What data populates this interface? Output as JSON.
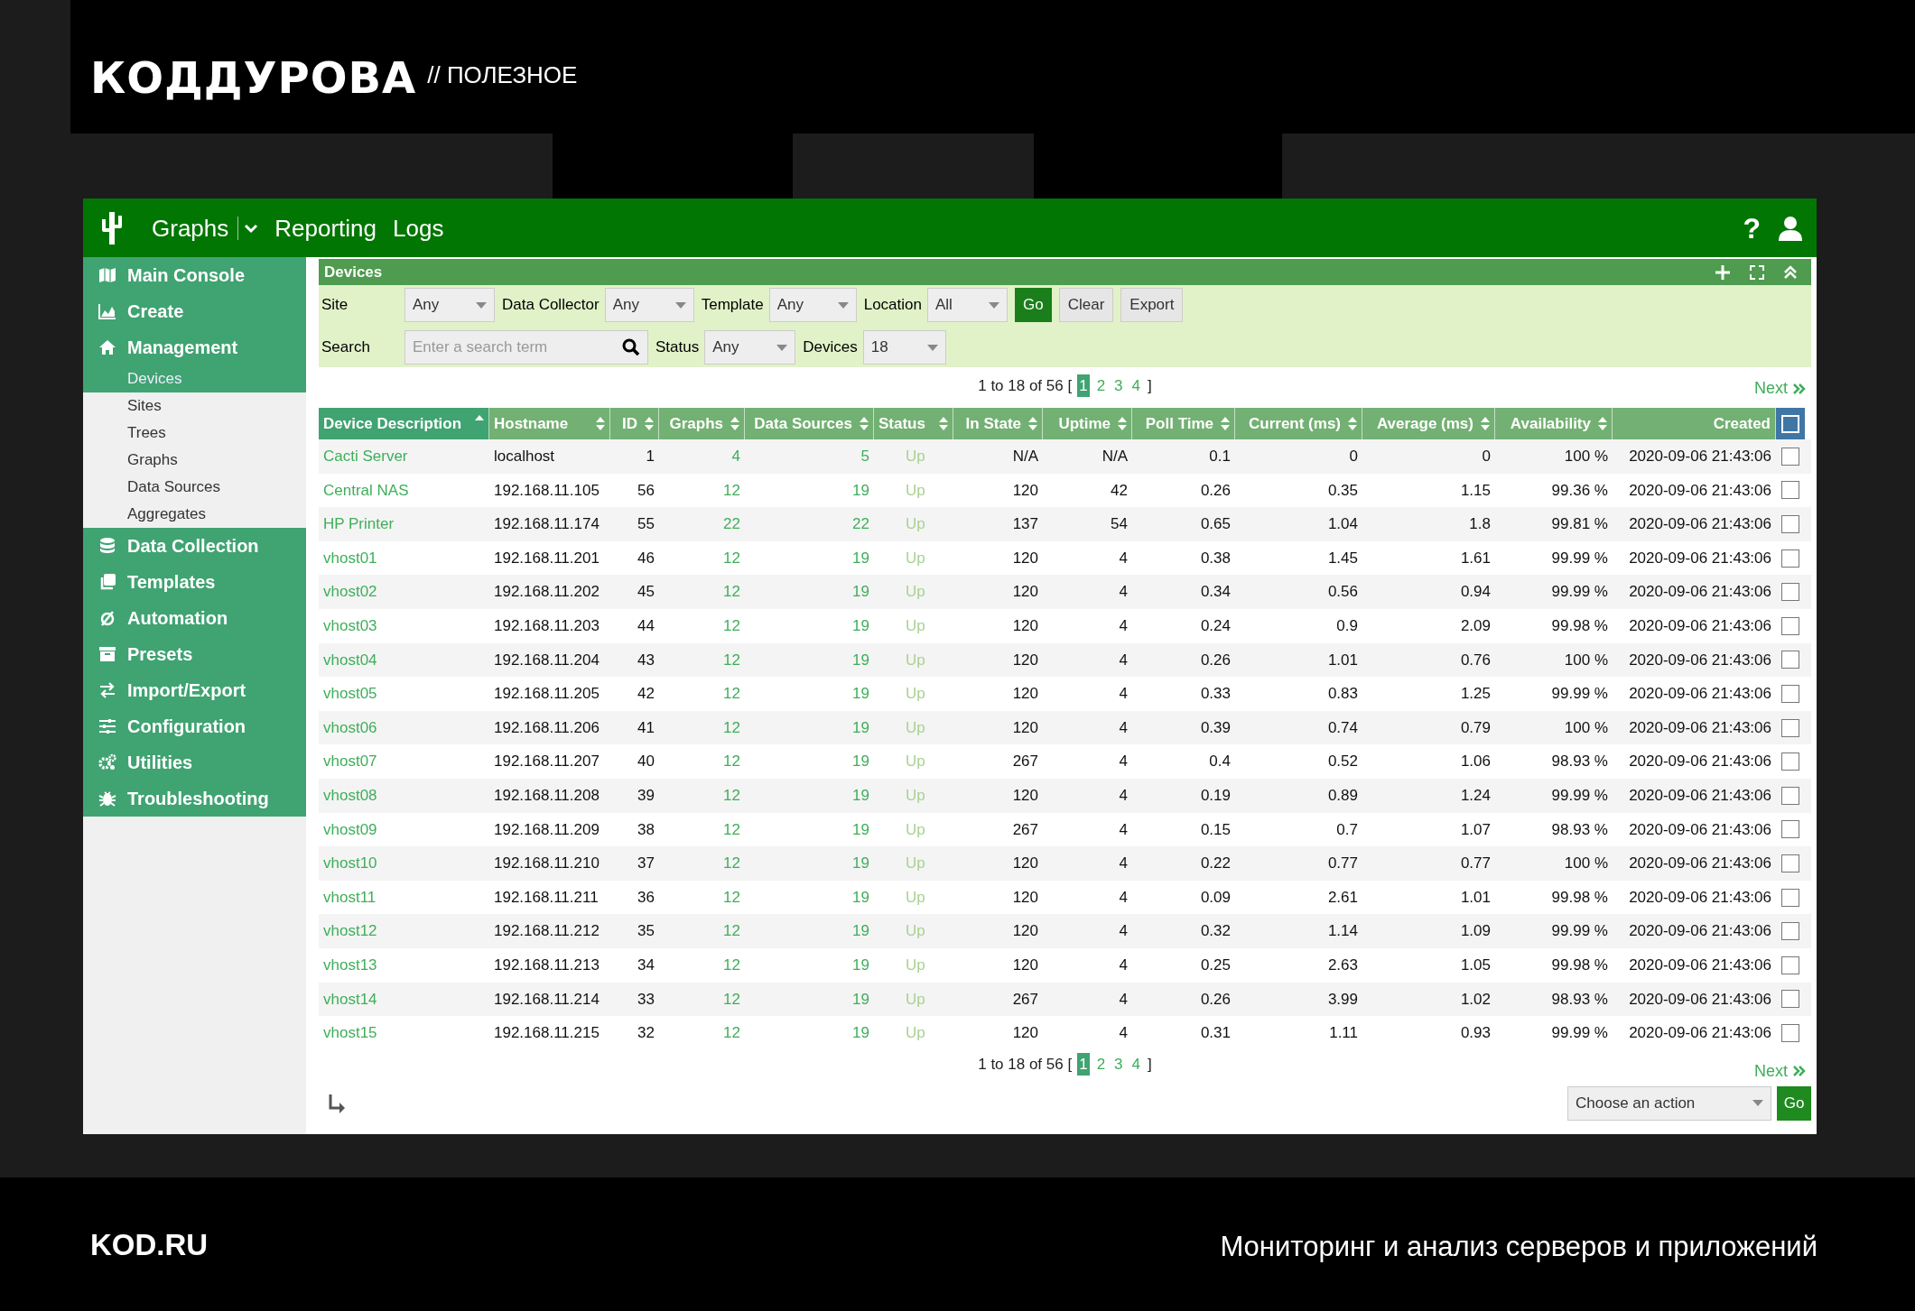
{
  "branding": {
    "logo": "КОДДУРОВА",
    "tagline": "// ПОЛЕЗНОЕ",
    "site": "KOD.RU",
    "caption": "Мониторинг и анализ серверов и приложений"
  },
  "navbar": {
    "tabs": [
      {
        "label": "Graphs",
        "dropdown": true
      },
      {
        "label": "Reporting",
        "dropdown": false
      },
      {
        "label": "Logs",
        "dropdown": false
      }
    ],
    "help": "?"
  },
  "sidebar": {
    "items": [
      {
        "label": "Main Console"
      },
      {
        "label": "Create"
      },
      {
        "label": "Management",
        "children": [
          {
            "label": "Devices",
            "selected": true
          },
          {
            "label": "Sites",
            "selected": false
          },
          {
            "label": "Trees",
            "selected": false
          },
          {
            "label": "Graphs",
            "selected": false
          },
          {
            "label": "Data Sources",
            "selected": false
          },
          {
            "label": "Aggregates",
            "selected": false
          }
        ]
      },
      {
        "label": "Data Collection"
      },
      {
        "label": "Templates"
      },
      {
        "label": "Automation"
      },
      {
        "label": "Presets"
      },
      {
        "label": "Import/Export"
      },
      {
        "label": "Configuration"
      },
      {
        "label": "Utilities"
      },
      {
        "label": "Troubleshooting"
      }
    ]
  },
  "panel": {
    "title": "Devices",
    "filter_rows": [
      [
        {
          "kind": "select",
          "label": "Site",
          "value": "Any"
        },
        {
          "kind": "select",
          "label": "Data Collector",
          "value": "Any"
        },
        {
          "kind": "select",
          "label": "Template",
          "value": "Any"
        },
        {
          "kind": "select",
          "label": "Location",
          "value": "All"
        },
        {
          "kind": "primary_button",
          "label": "Go"
        },
        {
          "kind": "button",
          "label": "Clear"
        },
        {
          "kind": "button",
          "label": "Export"
        }
      ],
      [
        {
          "kind": "search",
          "label": "Search",
          "placeholder": "Enter a search term"
        },
        {
          "kind": "select",
          "label": "Status",
          "value": "Any"
        },
        {
          "kind": "select",
          "label": "Devices",
          "value": "18"
        }
      ]
    ],
    "pagination_top": {
      "summary": "1 to 18 of 56 [",
      "pages": [
        {
          "label": "1",
          "selected": true
        },
        {
          "label": "2",
          "selected": false
        },
        {
          "label": "3",
          "selected": false
        },
        {
          "label": "4",
          "selected": false
        }
      ],
      "close": "]",
      "next": "Next"
    },
    "table": {
      "columns": [
        {
          "label": "Device Description",
          "sortable": true,
          "sorted": true
        },
        {
          "label": "Hostname",
          "sortable": true,
          "sorted": false
        },
        {
          "label": "ID",
          "sortable": true,
          "sorted": false
        },
        {
          "label": "Graphs",
          "sortable": true,
          "sorted": false
        },
        {
          "label": "Data Sources",
          "sortable": true,
          "sorted": false
        },
        {
          "label": "Status",
          "sortable": true,
          "sorted": false
        },
        {
          "label": "In State",
          "sortable": true,
          "sorted": false
        },
        {
          "label": "Uptime",
          "sortable": true,
          "sorted": false
        },
        {
          "label": "Poll Time",
          "sortable": true,
          "sorted": false
        },
        {
          "label": "Current (ms)",
          "sortable": true,
          "sorted": false
        },
        {
          "label": "Average (ms)",
          "sortable": true,
          "sorted": false
        },
        {
          "label": "Availability",
          "sortable": true,
          "sorted": false
        },
        {
          "label": "Created",
          "sortable": false,
          "sorted": false
        }
      ],
      "select_all": {
        "checked": false
      },
      "rows": [
        {
          "cells": [
            "Cacti Server",
            "localhost",
            "1",
            "4",
            "5",
            "Up",
            "N/A",
            "N/A",
            "0.1",
            "0",
            "0",
            "100 %",
            "2020-09-06 21:43:06"
          ],
          "checked": false
        },
        {
          "cells": [
            "Central NAS",
            "192.168.11.105",
            "56",
            "12",
            "19",
            "Up",
            "120",
            "42",
            "0.26",
            "0.35",
            "1.15",
            "99.36 %",
            "2020-09-06 21:43:06"
          ],
          "checked": false
        },
        {
          "cells": [
            "HP Printer",
            "192.168.11.174",
            "55",
            "22",
            "22",
            "Up",
            "137",
            "54",
            "0.65",
            "1.04",
            "1.8",
            "99.81 %",
            "2020-09-06 21:43:06"
          ],
          "checked": false
        },
        {
          "cells": [
            "vhost01",
            "192.168.11.201",
            "46",
            "12",
            "19",
            "Up",
            "120",
            "4",
            "0.38",
            "1.45",
            "1.61",
            "99.99 %",
            "2020-09-06 21:43:06"
          ],
          "checked": false
        },
        {
          "cells": [
            "vhost02",
            "192.168.11.202",
            "45",
            "12",
            "19",
            "Up",
            "120",
            "4",
            "0.34",
            "0.56",
            "0.94",
            "99.99 %",
            "2020-09-06 21:43:06"
          ],
          "checked": false
        },
        {
          "cells": [
            "vhost03",
            "192.168.11.203",
            "44",
            "12",
            "19",
            "Up",
            "120",
            "4",
            "0.24",
            "0.9",
            "2.09",
            "99.98 %",
            "2020-09-06 21:43:06"
          ],
          "checked": false
        },
        {
          "cells": [
            "vhost04",
            "192.168.11.204",
            "43",
            "12",
            "19",
            "Up",
            "120",
            "4",
            "0.26",
            "1.01",
            "0.76",
            "100 %",
            "2020-09-06 21:43:06"
          ],
          "checked": false
        },
        {
          "cells": [
            "vhost05",
            "192.168.11.205",
            "42",
            "12",
            "19",
            "Up",
            "120",
            "4",
            "0.33",
            "0.83",
            "1.25",
            "99.99 %",
            "2020-09-06 21:43:06"
          ],
          "checked": false
        },
        {
          "cells": [
            "vhost06",
            "192.168.11.206",
            "41",
            "12",
            "19",
            "Up",
            "120",
            "4",
            "0.39",
            "0.74",
            "0.79",
            "100 %",
            "2020-09-06 21:43:06"
          ],
          "checked": false
        },
        {
          "cells": [
            "vhost07",
            "192.168.11.207",
            "40",
            "12",
            "19",
            "Up",
            "267",
            "4",
            "0.4",
            "0.52",
            "1.06",
            "98.93 %",
            "2020-09-06 21:43:06"
          ],
          "checked": false
        },
        {
          "cells": [
            "vhost08",
            "192.168.11.208",
            "39",
            "12",
            "19",
            "Up",
            "120",
            "4",
            "0.19",
            "0.89",
            "1.24",
            "99.99 %",
            "2020-09-06 21:43:06"
          ],
          "checked": false
        },
        {
          "cells": [
            "vhost09",
            "192.168.11.209",
            "38",
            "12",
            "19",
            "Up",
            "267",
            "4",
            "0.15",
            "0.7",
            "1.07",
            "98.93 %",
            "2020-09-06 21:43:06"
          ],
          "checked": false
        },
        {
          "cells": [
            "vhost10",
            "192.168.11.210",
            "37",
            "12",
            "19",
            "Up",
            "120",
            "4",
            "0.22",
            "0.77",
            "0.77",
            "100 %",
            "2020-09-06 21:43:06"
          ],
          "checked": false
        },
        {
          "cells": [
            "vhost11",
            "192.168.11.211",
            "36",
            "12",
            "19",
            "Up",
            "120",
            "4",
            "0.09",
            "2.61",
            "1.01",
            "99.98 %",
            "2020-09-06 21:43:06"
          ],
          "checked": false
        },
        {
          "cells": [
            "vhost12",
            "192.168.11.212",
            "35",
            "12",
            "19",
            "Up",
            "120",
            "4",
            "0.32",
            "1.14",
            "1.09",
            "99.99 %",
            "2020-09-06 21:43:06"
          ],
          "checked": false
        },
        {
          "cells": [
            "vhost13",
            "192.168.11.213",
            "34",
            "12",
            "19",
            "Up",
            "120",
            "4",
            "0.25",
            "2.63",
            "1.05",
            "99.98 %",
            "2020-09-06 21:43:06"
          ],
          "checked": false
        },
        {
          "cells": [
            "vhost14",
            "192.168.11.214",
            "33",
            "12",
            "19",
            "Up",
            "267",
            "4",
            "0.26",
            "3.99",
            "1.02",
            "98.93 %",
            "2020-09-06 21:43:06"
          ],
          "checked": false
        },
        {
          "cells": [
            "vhost15",
            "192.168.11.215",
            "32",
            "12",
            "19",
            "Up",
            "120",
            "4",
            "0.31",
            "1.11",
            "0.93",
            "99.99 %",
            "2020-09-06 21:43:06"
          ],
          "checked": false
        }
      ]
    },
    "pagination_bottom": {
      "summary": "1 to 18 of 56 [",
      "pages": [
        {
          "label": "1",
          "selected": true
        },
        {
          "label": "2",
          "selected": false
        },
        {
          "label": "3",
          "selected": false
        },
        {
          "label": "4",
          "selected": false
        }
      ],
      "close": "]",
      "next": "Next"
    },
    "actions": {
      "select": "Choose an action",
      "button": "Go"
    }
  }
}
